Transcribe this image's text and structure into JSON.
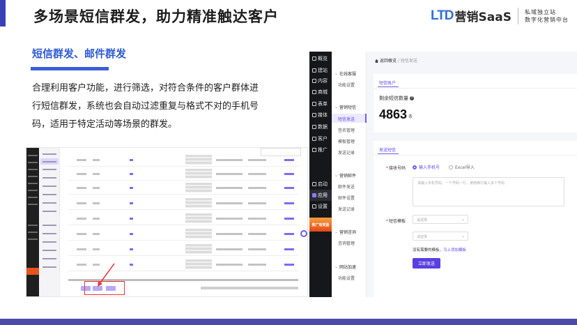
{
  "header": {
    "title": "多场景短信群发，助力精准触达客户",
    "brand_ltd": "LTD",
    "brand_name": "营销SaaS",
    "brand_tagline_1": "私域独立站",
    "brand_tagline_2": "数字化营销中台"
  },
  "section": {
    "title": "短信群发、邮件群发",
    "body": "合理利用客户功能，进行筛选，对符合条件的客户群体进行短信群发，系统也会自动过滤重复与格式不对的手机号码，适用于特定活动等场景的群发。"
  },
  "app": {
    "sidebar": [
      {
        "label": "概览",
        "icon": "overview-icon"
      },
      {
        "label": "建站",
        "icon": "site-icon"
      },
      {
        "label": "内容",
        "icon": "content-icon"
      },
      {
        "label": "商城",
        "icon": "shop-icon"
      },
      {
        "label": "表单",
        "icon": "form-icon"
      },
      {
        "label": "媒体",
        "icon": "media-icon"
      },
      {
        "label": "数据",
        "icon": "data-icon"
      },
      {
        "label": "客户",
        "icon": "customer-icon"
      },
      {
        "label": "推广",
        "icon": "promote-icon"
      },
      {
        "label": "启动",
        "icon": "launch-icon"
      },
      {
        "label": "应用",
        "icon": "apps-icon"
      },
      {
        "label": "设置",
        "icon": "settings-icon"
      }
    ],
    "promo": "推广有奖励",
    "submenu": {
      "group1": "在线客服",
      "g1_items": [
        "功能设置"
      ],
      "group2": "营销短信",
      "g2_items": [
        "短信发送",
        "签名管理",
        "模板管理",
        "发送记录"
      ],
      "group3": "营销邮件",
      "g3_items": [
        "邮件发送",
        "邮件设置",
        "发送记录"
      ],
      "group4": "营销咨询",
      "g4_items": [
        "咨询管理"
      ],
      "group5": "网站加速",
      "g5_items": [
        "功能设置"
      ]
    },
    "breadcrumb": {
      "back": "返回概览",
      "sep": "/",
      "current": "短信发送"
    },
    "account": {
      "tab": "短信账户",
      "remain_label": "剩余短信数量",
      "remain_value": "4863",
      "remain_unit": "条"
    },
    "send": {
      "tab": "发送短信",
      "receiver_label": "接收号码",
      "radio_manual": "输入手机号",
      "radio_excel": "Excel导入",
      "textarea_placeholder": "请输入手机号码，一个号码一行，使用换行输入多个号码",
      "template_label": "短信模板",
      "template_placeholder": "请选择",
      "signature_placeholder": "请选择",
      "hint_text": "没有需要的模板，",
      "hint_link": "马上添加模板",
      "submit": "立即发送"
    }
  }
}
